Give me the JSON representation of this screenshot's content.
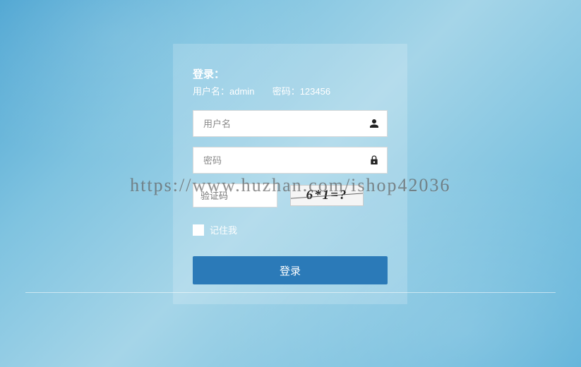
{
  "login": {
    "title": "登录：",
    "hint_user_label": "用户名：",
    "hint_user_value": "admin",
    "hint_pass_label": "密码：",
    "hint_pass_value": "123456",
    "username_placeholder": "用户名",
    "password_placeholder": "密码",
    "captcha_placeholder": "验证码",
    "captcha_text": "6*1=?",
    "remember_label": "记住我",
    "submit_label": "登录"
  },
  "watermark": "https://www.huzhan.com/ishop42036"
}
